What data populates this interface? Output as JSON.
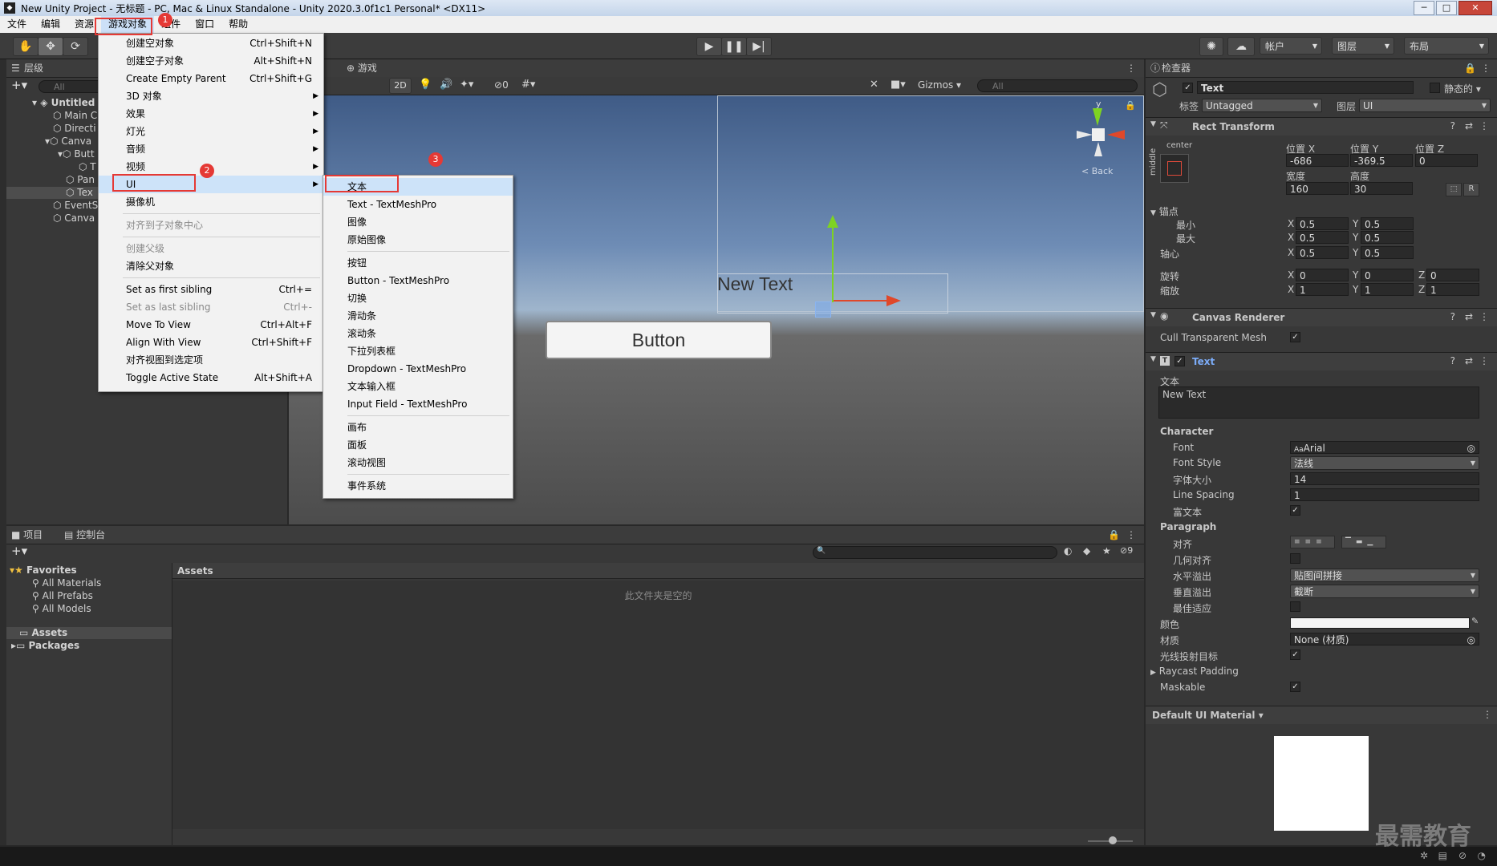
{
  "window": {
    "title": "New Unity Project - 无标题 - PC, Mac & Linux Standalone - Unity 2020.3.0f1c1 Personal* <DX11>",
    "logo": "unity-logo",
    "min": "─",
    "max": "□",
    "close": "✕"
  },
  "menubar": {
    "items": [
      "文件",
      "编辑",
      "资源",
      "游戏对象",
      "组件",
      "窗口",
      "帮助"
    ]
  },
  "badges": [
    "1",
    "2",
    "3"
  ],
  "toolbar": {
    "account": "帐户",
    "layers": "图层",
    "layout": "布局"
  },
  "hierarchy": {
    "tab": "层级",
    "search_placeholder": "All",
    "items": [
      {
        "label": "Untitled",
        "depth": 0
      },
      {
        "label": "Main C",
        "depth": 1
      },
      {
        "label": "Directi",
        "depth": 1
      },
      {
        "label": "Canva",
        "depth": 1
      },
      {
        "label": "Butt",
        "depth": 2
      },
      {
        "label": "T",
        "depth": 3
      },
      {
        "label": "Pan",
        "depth": 2
      },
      {
        "label": "Tex",
        "depth": 2
      },
      {
        "label": "EventS",
        "depth": 1
      },
      {
        "label": "Canva",
        "depth": 1
      }
    ]
  },
  "scene": {
    "tab_game": "游戏",
    "mode_2d": "2D",
    "gizmos": "Gizmos",
    "hidden_count": "0",
    "search_placeholder": "All",
    "back_label": "< Back",
    "new_text": "New Text",
    "button_text": "Button",
    "axis_y": "y"
  },
  "gameobject_menu": {
    "items": [
      {
        "label": "创建空对象",
        "shortcut": "Ctrl+Shift+N"
      },
      {
        "label": "创建空子对象",
        "shortcut": "Alt+Shift+N"
      },
      {
        "label": "Create Empty Parent",
        "shortcut": "Ctrl+Shift+G"
      },
      {
        "label": "3D 对象",
        "arrow": "▶"
      },
      {
        "label": "效果",
        "arrow": "▶"
      },
      {
        "label": "灯光",
        "arrow": "▶"
      },
      {
        "label": "音频",
        "arrow": "▶"
      },
      {
        "label": "视频",
        "arrow": "▶"
      },
      {
        "label": "UI",
        "arrow": "▶"
      },
      {
        "label": "摄像机"
      },
      {
        "label": "对齐到子对象中心",
        "disabled": true
      },
      {
        "label": "创建父级",
        "disabled": true
      },
      {
        "label": "清除父对象"
      },
      {
        "label": "Set as first sibling",
        "shortcut": "Ctrl+="
      },
      {
        "label": "Set as last sibling",
        "shortcut": "Ctrl+-",
        "disabled": true
      },
      {
        "label": "Move To View",
        "shortcut": "Ctrl+Alt+F"
      },
      {
        "label": "Align With View",
        "shortcut": "Ctrl+Shift+F"
      },
      {
        "label": "对齐视图到选定项"
      },
      {
        "label": "Toggle Active State",
        "shortcut": "Alt+Shift+A"
      }
    ]
  },
  "ui_submenu": {
    "items": [
      "文本",
      "Text - TextMeshPro",
      "图像",
      "原始图像",
      "按钮",
      "Button - TextMeshPro",
      "切换",
      "滑动条",
      "滚动条",
      "下拉列表框",
      "Dropdown - TextMeshPro",
      "文本输入框",
      "Input Field - TextMeshPro",
      "画布",
      "面板",
      "滚动视图",
      "事件系统"
    ]
  },
  "project": {
    "tab_project": "项目",
    "tab_console": "控制台",
    "hidden_count": "9",
    "favorites": "Favorites",
    "fav_items": [
      "All Materials",
      "All Prefabs",
      "All Models"
    ],
    "assets": "Assets",
    "packages": "Packages",
    "assets_header": "Assets",
    "empty_msg": "此文件夹是空的"
  },
  "inspector": {
    "tab": "检查器",
    "object_name": "Text",
    "static_label": "静态的",
    "tag_label": "标签",
    "tag_value": "Untagged",
    "layer_label": "图层",
    "layer_value": "UI",
    "rect_transform": {
      "title": "Rect Transform",
      "anchor_h": "center",
      "anchor_v": "middle",
      "pos_x_label": "位置 X",
      "pos_y_label": "位置 Y",
      "pos_z_label": "位置 Z",
      "pos_x": "-686",
      "pos_y": "-369.5",
      "pos_z": "0",
      "width_label": "宽度",
      "height_label": "高度",
      "width": "160",
      "height": "30",
      "raw_edit": "R",
      "anchors_label": "锚点",
      "min_label": "最小",
      "max_label": "最大",
      "pivot_label": "轴心",
      "min_x": "0.5",
      "min_y": "0.5",
      "max_x": "0.5",
      "max_y": "0.5",
      "pivot_x": "0.5",
      "pivot_y": "0.5",
      "rotation_label": "旋转",
      "scale_label": "缩放",
      "rot_x": "0",
      "rot_y": "0",
      "rot_z": "0",
      "scale_x": "1",
      "scale_y": "1",
      "scale_z": "1",
      "x": "X",
      "y": "Y",
      "z": "Z"
    },
    "canvas_renderer": {
      "title": "Canvas Renderer",
      "cull_label": "Cull Transparent Mesh"
    },
    "text_comp": {
      "title": "Text",
      "text_label": "文本",
      "text_value": "New Text",
      "character": "Character",
      "font_label": "Font",
      "font_value": "Arial",
      "font_style_label": "Font Style",
      "font_style_value": "法线",
      "font_size_label": "字体大小",
      "font_size_value": "14",
      "line_spacing_label": "Line Spacing",
      "line_spacing_value": "1",
      "rich_text_label": "富文本",
      "paragraph": "Paragraph",
      "align_label": "对齐",
      "geo_align_label": "几何对齐",
      "h_overflow_label": "水平溢出",
      "h_overflow_value": "贴图间拼接",
      "v_overflow_label": "垂直溢出",
      "v_overflow_value": "截断",
      "best_fit_label": "最佳适应",
      "color_label": "颜色",
      "material_label": "材质",
      "material_value": "None (材质)",
      "raycast_label": "光线投射目标",
      "raycast_padding_label": "Raycast Padding",
      "maskable_label": "Maskable"
    },
    "material_preview": "Default UI Material"
  },
  "watermark": "最需教育",
  "colors": {
    "accent": "#3a79d8",
    "redbox": "#e53935",
    "selected": "#2c5d87"
  }
}
